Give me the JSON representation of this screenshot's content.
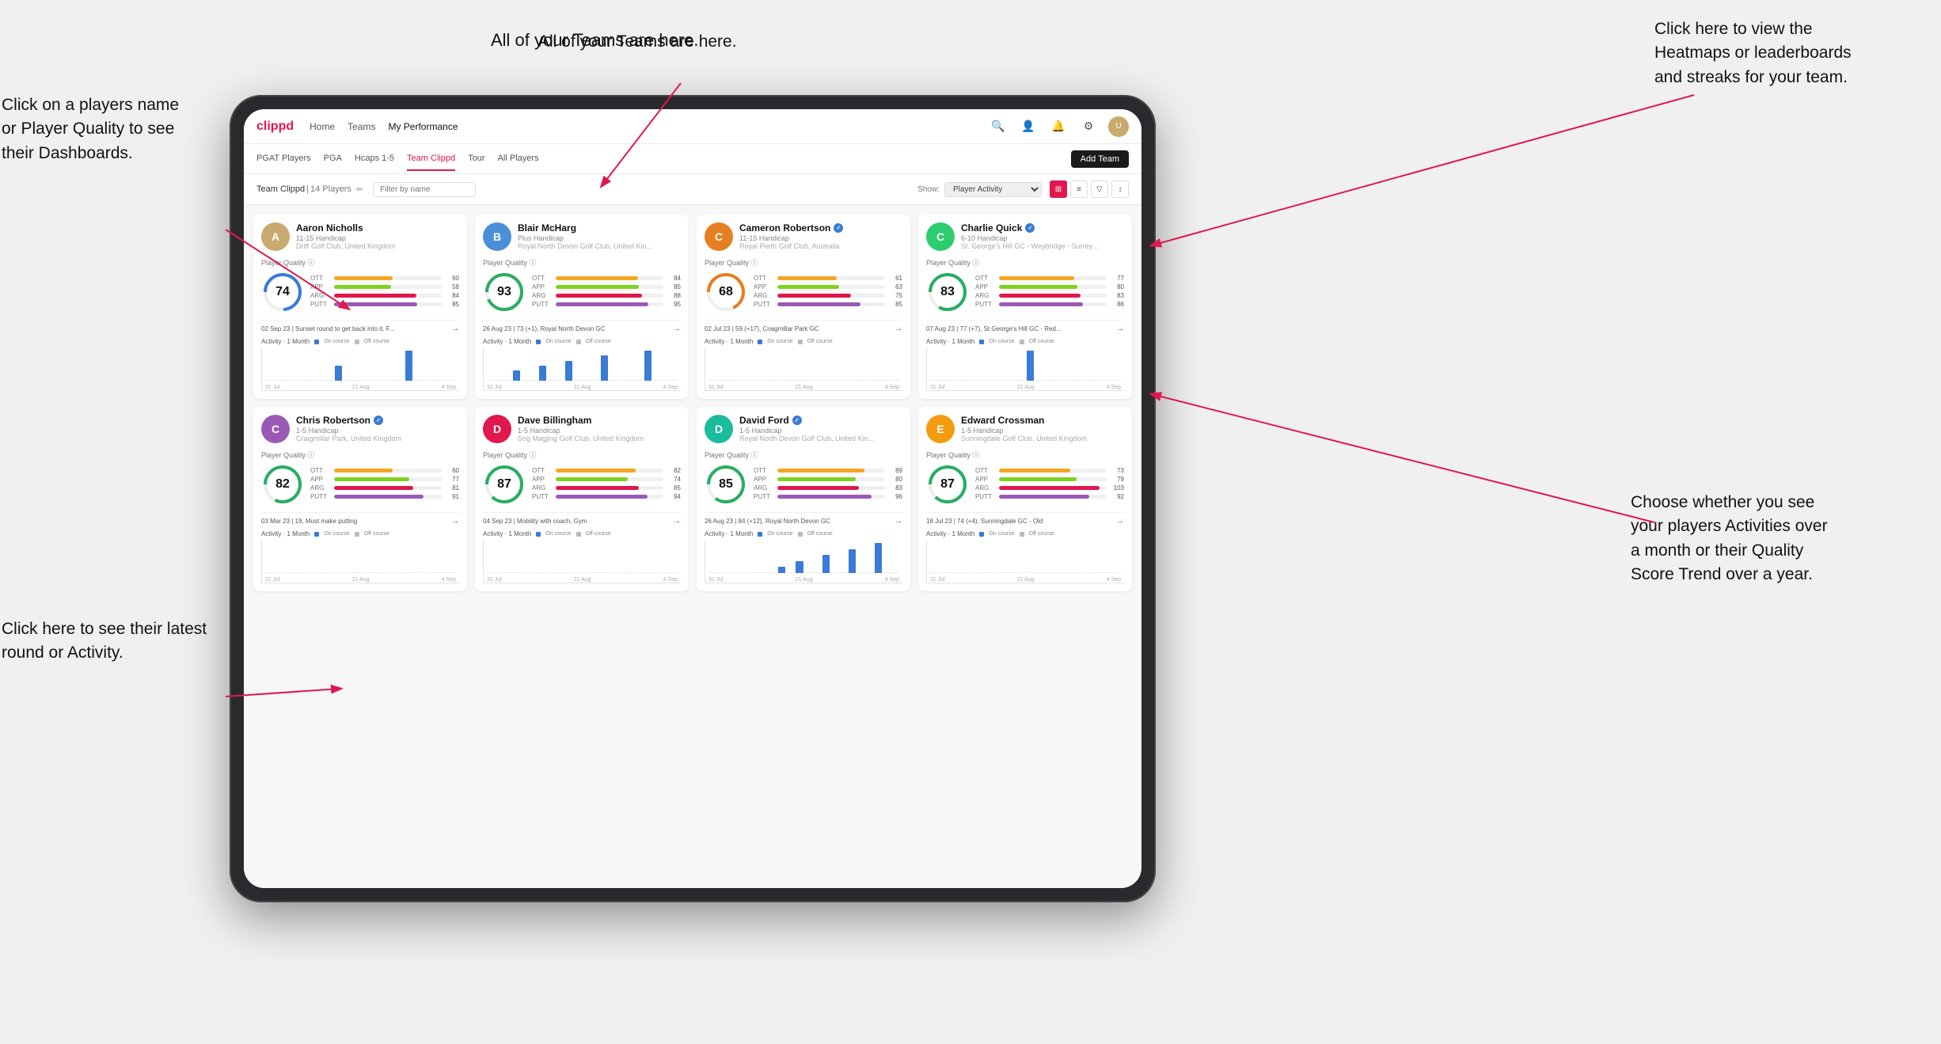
{
  "annotations": {
    "teams_tooltip": "All of your Teams are here.",
    "heatmaps_tooltip": "Click here to view the\nHeatmaps or leaderboards\nand streaks for your team.",
    "player_name_tooltip": "Click on a players name\nor Player Quality to see\ntheir Dashboards.",
    "activities_tooltip": "Choose whether you see\nyour players Activities over\na month or their Quality\nScore Trend over a year.",
    "latest_round_tooltip": "Click here to see their latest\nround or Activity."
  },
  "nav": {
    "logo": "clippd",
    "items": [
      "Home",
      "Teams",
      "My Performance"
    ],
    "icons": [
      "search",
      "person",
      "bell",
      "settings",
      "avatar"
    ]
  },
  "sub_nav": {
    "items": [
      "PGAT Players",
      "PGA",
      "Hcaps 1-5",
      "Team Clippd",
      "Tour",
      "All Players"
    ],
    "active": "Team Clippd",
    "add_team_label": "Add Team"
  },
  "team_header": {
    "name": "Team Clippd",
    "count": "14 Players",
    "show_label": "Show:",
    "show_option": "Player Activity",
    "filter_placeholder": "Filter by name"
  },
  "players": [
    {
      "name": "Aaron Nicholls",
      "handicap": "11-15 Handicap",
      "club": "Drift Golf Club, United Kingdom",
      "quality": 74,
      "quality_color": "#3a7bd5",
      "verified": false,
      "stats": {
        "OTT": {
          "value": 60,
          "color": "#f5a623"
        },
        "APP": {
          "value": 58,
          "color": "#7ed321"
        },
        "ARG": {
          "value": 84,
          "color": "#e0184d"
        },
        "PUTT": {
          "value": 85,
          "color": "#9b59b6"
        }
      },
      "last_round": "02 Sep 23 | Sunset round to get back into it. F...",
      "activity_bars": [
        0,
        0,
        0,
        0,
        0,
        0,
        0,
        0,
        1,
        0,
        0,
        0,
        0,
        0,
        0,
        0,
        2,
        0,
        0,
        0,
        0,
        0
      ],
      "chart_labels": [
        "31 Jul",
        "21 Aug",
        "4 Sep"
      ]
    },
    {
      "name": "Blair McHarg",
      "handicap": "Plus Handicap",
      "club": "Royal North Devon Golf Club, United Kin...",
      "quality": 93,
      "quality_color": "#27ae60",
      "verified": false,
      "stats": {
        "OTT": {
          "value": 84,
          "color": "#f5a623"
        },
        "APP": {
          "value": 85,
          "color": "#7ed321"
        },
        "ARG": {
          "value": 88,
          "color": "#e0184d"
        },
        "PUTT": {
          "value": 95,
          "color": "#9b59b6"
        }
      },
      "last_round": "26 Aug 23 | 73 (+1), Royal North Devon GC",
      "activity_bars": [
        0,
        0,
        0,
        2,
        0,
        0,
        3,
        0,
        0,
        4,
        0,
        0,
        0,
        5,
        0,
        0,
        0,
        0,
        6,
        0,
        0,
        0
      ],
      "chart_labels": [
        "31 Jul",
        "21 Aug",
        "4 Sep"
      ]
    },
    {
      "name": "Cameron Robertson",
      "handicap": "11-15 Handicap",
      "club": "Royal Perth Golf Club, Australia",
      "quality": 68,
      "quality_color": "#e67e22",
      "verified": true,
      "stats": {
        "OTT": {
          "value": 61,
          "color": "#f5a623"
        },
        "APP": {
          "value": 63,
          "color": "#7ed321"
        },
        "ARG": {
          "value": 75,
          "color": "#e0184d"
        },
        "PUTT": {
          "value": 85,
          "color": "#9b59b6"
        }
      },
      "last_round": "02 Jul 23 | 59 (+17), Craigmillar Park GC",
      "activity_bars": [
        0,
        0,
        0,
        0,
        0,
        0,
        0,
        0,
        0,
        0,
        0,
        0,
        0,
        0,
        0,
        0,
        0,
        0,
        0,
        0,
        0,
        0
      ],
      "chart_labels": [
        "31 Jul",
        "21 Aug",
        "4 Sep"
      ]
    },
    {
      "name": "Charlie Quick",
      "handicap": "6-10 Handicap",
      "club": "St. George's Hill GC - Weybridge - Surrey...",
      "quality": 83,
      "quality_color": "#27ae60",
      "verified": true,
      "stats": {
        "OTT": {
          "value": 77,
          "color": "#f5a623"
        },
        "APP": {
          "value": 80,
          "color": "#7ed321"
        },
        "ARG": {
          "value": 83,
          "color": "#e0184d"
        },
        "PUTT": {
          "value": 86,
          "color": "#9b59b6"
        }
      },
      "last_round": "07 Aug 23 | 77 (+7), St George's Hill GC - Red...",
      "activity_bars": [
        0,
        0,
        0,
        0,
        0,
        0,
        0,
        0,
        0,
        0,
        0,
        3,
        0,
        0,
        0,
        0,
        0,
        0,
        0,
        0,
        0,
        0
      ],
      "chart_labels": [
        "31 Jul",
        "21 Aug",
        "4 Sep"
      ]
    },
    {
      "name": "Chris Robertson",
      "handicap": "1-5 Handicap",
      "club": "Craigmillar Park, United Kingdom",
      "quality": 82,
      "quality_color": "#27ae60",
      "verified": true,
      "stats": {
        "OTT": {
          "value": 60,
          "color": "#f5a623"
        },
        "APP": {
          "value": 77,
          "color": "#7ed321"
        },
        "ARG": {
          "value": 81,
          "color": "#e0184d"
        },
        "PUTT": {
          "value": 91,
          "color": "#9b59b6"
        }
      },
      "last_round": "03 Mar 23 | 19, Must make putting",
      "activity_bars": [
        0,
        0,
        0,
        0,
        0,
        0,
        0,
        0,
        0,
        0,
        0,
        0,
        0,
        0,
        0,
        0,
        0,
        0,
        0,
        0,
        0,
        0
      ],
      "chart_labels": [
        "31 Jul",
        "21 Aug",
        "4 Sep"
      ]
    },
    {
      "name": "Dave Billingham",
      "handicap": "1-5 Handicap",
      "club": "Sog Magjing Golf Club, United Kingdom",
      "quality": 87,
      "quality_color": "#27ae60",
      "verified": false,
      "stats": {
        "OTT": {
          "value": 82,
          "color": "#f5a623"
        },
        "APP": {
          "value": 74,
          "color": "#7ed321"
        },
        "ARG": {
          "value": 85,
          "color": "#e0184d"
        },
        "PUTT": {
          "value": 94,
          "color": "#9b59b6"
        }
      },
      "last_round": "04 Sep 23 | Mobility with coach, Gym",
      "activity_bars": [
        0,
        0,
        0,
        0,
        0,
        0,
        0,
        0,
        0,
        0,
        0,
        0,
        0,
        0,
        0,
        0,
        0,
        0,
        0,
        0,
        0,
        0
      ],
      "chart_labels": [
        "31 Jul",
        "21 Aug",
        "4 Sep"
      ]
    },
    {
      "name": "David Ford",
      "handicap": "1-5 Handicap",
      "club": "Royal North Devon Golf Club, United Kin...",
      "quality": 85,
      "quality_color": "#27ae60",
      "verified": true,
      "stats": {
        "OTT": {
          "value": 89,
          "color": "#f5a623"
        },
        "APP": {
          "value": 80,
          "color": "#7ed321"
        },
        "ARG": {
          "value": 83,
          "color": "#e0184d"
        },
        "PUTT": {
          "value": 96,
          "color": "#9b59b6"
        }
      },
      "last_round": "26 Aug 23 | 84 (+12), Royal North Devon GC",
      "activity_bars": [
        0,
        0,
        0,
        0,
        0,
        0,
        0,
        0,
        2,
        0,
        4,
        0,
        0,
        6,
        0,
        0,
        8,
        0,
        0,
        10,
        0,
        0
      ],
      "chart_labels": [
        "31 Jul",
        "21 Aug",
        "4 Sep"
      ]
    },
    {
      "name": "Edward Crossman",
      "handicap": "1-5 Handicap",
      "club": "Sunningdale Golf Club, United Kingdom",
      "quality": 87,
      "quality_color": "#27ae60",
      "verified": false,
      "stats": {
        "OTT": {
          "value": 73,
          "color": "#f5a623"
        },
        "APP": {
          "value": 79,
          "color": "#7ed321"
        },
        "ARG": {
          "value": 103,
          "color": "#e0184d"
        },
        "PUTT": {
          "value": 92,
          "color": "#9b59b6"
        }
      },
      "last_round": "18 Jul 23 | 74 (+4), Sunningdale GC - Old",
      "activity_bars": [
        0,
        0,
        0,
        0,
        0,
        0,
        0,
        0,
        0,
        0,
        0,
        0,
        0,
        0,
        0,
        0,
        0,
        0,
        0,
        0,
        0,
        0
      ],
      "chart_labels": [
        "31 Jul",
        "21 Aug",
        "4 Sep"
      ]
    }
  ],
  "avatar_colors": [
    "#c8a96e",
    "#4a90d9",
    "#e67e22",
    "#2ecc71",
    "#9b59b6",
    "#e0184d",
    "#1abc9c",
    "#f39c12"
  ],
  "activity": {
    "title": "Activity",
    "period": "1 Month",
    "on_course": "On course",
    "off_course": "Off course",
    "on_color": "#3a7bd5",
    "off_color": "#aaa"
  }
}
